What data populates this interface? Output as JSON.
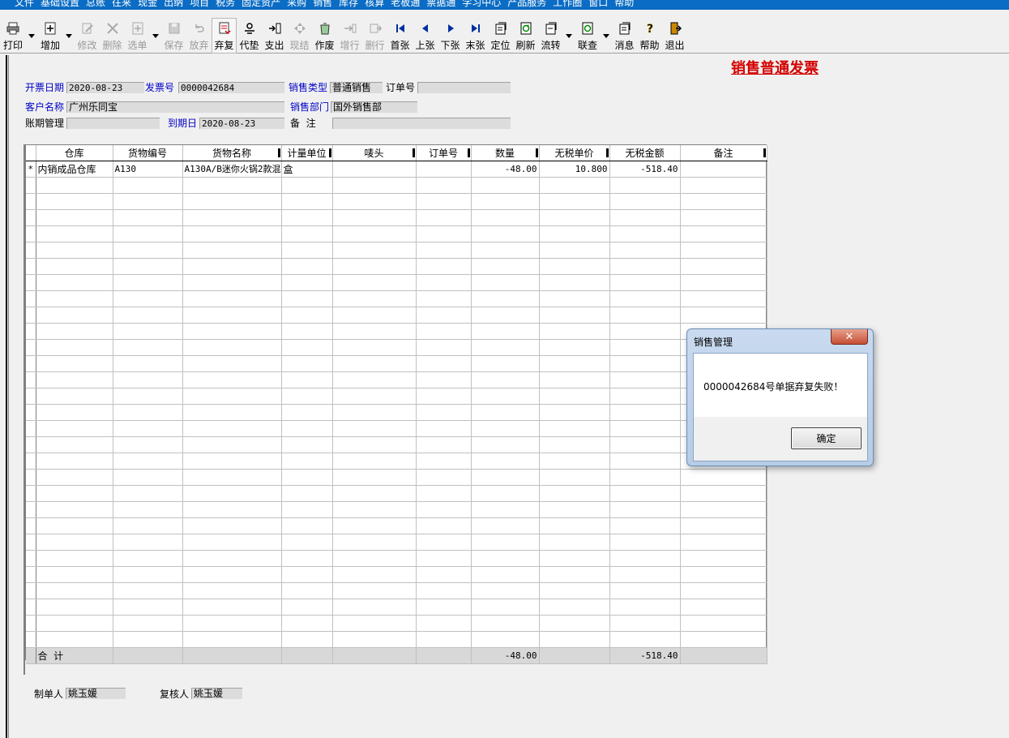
{
  "menu": [
    "文件",
    "基础设置",
    "总账",
    "往来",
    "现金",
    "出纳",
    "项目",
    "税务",
    "固定资产",
    "采购",
    "销售",
    "库存",
    "核算",
    "老板通",
    "票据通",
    "学习中心",
    "产品服务",
    "工作圈",
    "窗口",
    "帮助"
  ],
  "toolbar": {
    "print": "打印",
    "add": "增加",
    "edit": "修改",
    "delete": "删除",
    "select": "选单",
    "save": "保存",
    "abandon": "放弃",
    "discard_restore": "弃复",
    "advance": "代垫",
    "expense": "支出",
    "settle": "现结",
    "void": "作废",
    "add_row": "增行",
    "del_row": "删行",
    "first": "首张",
    "prev": "上张",
    "next": "下张",
    "last": "末张",
    "locate": "定位",
    "refresh": "刷新",
    "flow": "流转",
    "link": "联查",
    "message": "消息",
    "help": "帮助",
    "exit": "退出"
  },
  "title": "销售普通发票",
  "header": {
    "invoice_date_label": "开票日期",
    "invoice_date": "2020-08-23",
    "invoice_no_label": "发票号",
    "invoice_no": "0000042684",
    "sale_type_label": "销售类型",
    "sale_type": "普通销售",
    "order_no_label": "订单号",
    "order_no": "",
    "customer_label": "客户名称",
    "customer": "广州乐同宝",
    "dept_label": "销售部门",
    "dept": "国外销售部",
    "term_label": "账期管理",
    "term": "",
    "due_label": "到期日",
    "due": "2020-08-23",
    "remark_label": "备  注",
    "remark": ""
  },
  "grid": {
    "columns": [
      "仓库",
      "货物编号",
      "货物名称",
      "计量单位",
      "唛头",
      "订单号",
      "数量",
      "无税单价",
      "无税金额",
      "备注"
    ],
    "rows": [
      {
        "marker": "*",
        "warehouse": "内销成品仓库",
        "code": "A130",
        "name": "A130A/B迷你火锅2款混",
        "unit": "盒",
        "mark": "",
        "order": "",
        "qty": "-48.00",
        "price": "10.800",
        "amount": "-518.40",
        "note": ""
      }
    ],
    "total_label": "合  计",
    "total_qty": "-48.00",
    "total_amount": "-518.40"
  },
  "footer": {
    "maker_label": "制单人",
    "maker": "姚玉媛",
    "reviewer_label": "复核人",
    "reviewer": "姚玉媛"
  },
  "dialog": {
    "title": "销售管理",
    "message": "0000042684号单据弃复失败！",
    "ok": "确定"
  }
}
